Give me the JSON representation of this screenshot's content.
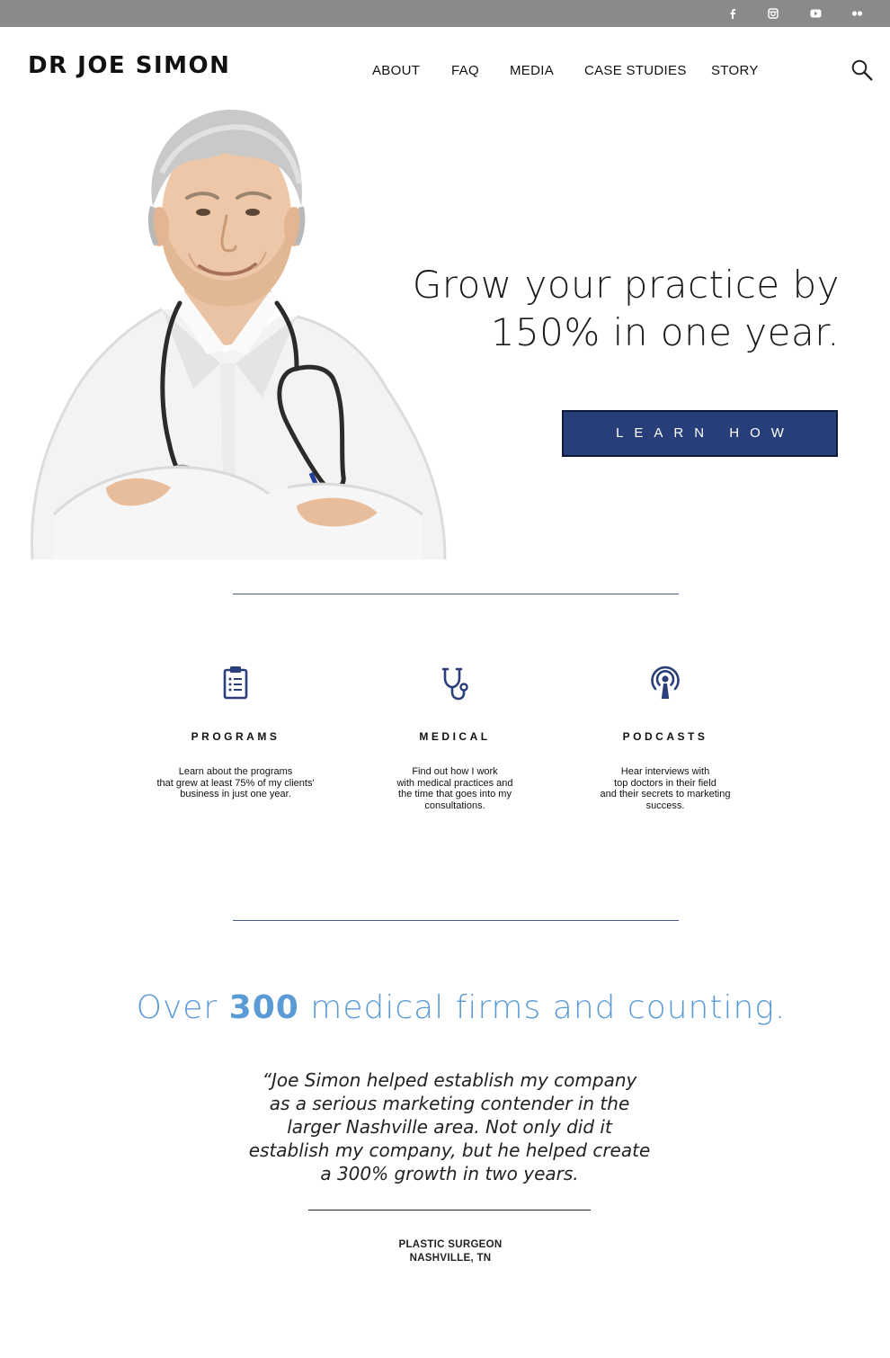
{
  "brand": {
    "logo_text": "DR JOE SIMON"
  },
  "social": [
    {
      "icon": "facebook-icon"
    },
    {
      "icon": "instagram-icon"
    },
    {
      "icon": "youtube-icon"
    },
    {
      "icon": "flickr-icon"
    }
  ],
  "nav": {
    "items": [
      {
        "label": "ABOUT"
      },
      {
        "label": "FAQ"
      },
      {
        "label": "MEDIA"
      },
      {
        "label": "CASE STUDIES"
      },
      {
        "label": "STORY"
      }
    ],
    "search_icon": "search-icon"
  },
  "hero": {
    "title_line1": "Grow your practice by",
    "title_line2": "150% in one year.",
    "cta_label": "LEARN HOW"
  },
  "features": [
    {
      "icon": "clipboard-icon",
      "title": "PROGRAMS",
      "text": "Learn about the programs\nthat grew at least 75% of my clients'\nbusiness in just one year."
    },
    {
      "icon": "stethoscope-icon",
      "title": "MEDICAL",
      "text": "Find out how I work\nwith medical practices and\nthe time that goes into my\nconsultations."
    },
    {
      "icon": "podcast-icon",
      "title": "PODCASTS",
      "text": "Hear interviews with\ntop doctors in their field\nand their secrets to marketing\nsuccess."
    }
  ],
  "stats": {
    "prefix": "Over ",
    "number": "300",
    "suffix": " medical firms and counting."
  },
  "testimonial": {
    "quote": "“Joe Simon helped establish my company\nas a serious marketing contender in the\nlarger Nashville area. Not only did it\nestablish my company, but he helped create\na 300% growth in two years.",
    "role": "PLASTIC SURGEON",
    "location": "NASHVILLE, TN"
  },
  "colors": {
    "topbar": "#8a8a8a",
    "cta_background": "#283e78",
    "accent_blue": "#5b9bd5",
    "icon_navy": "#2b3f7a"
  }
}
